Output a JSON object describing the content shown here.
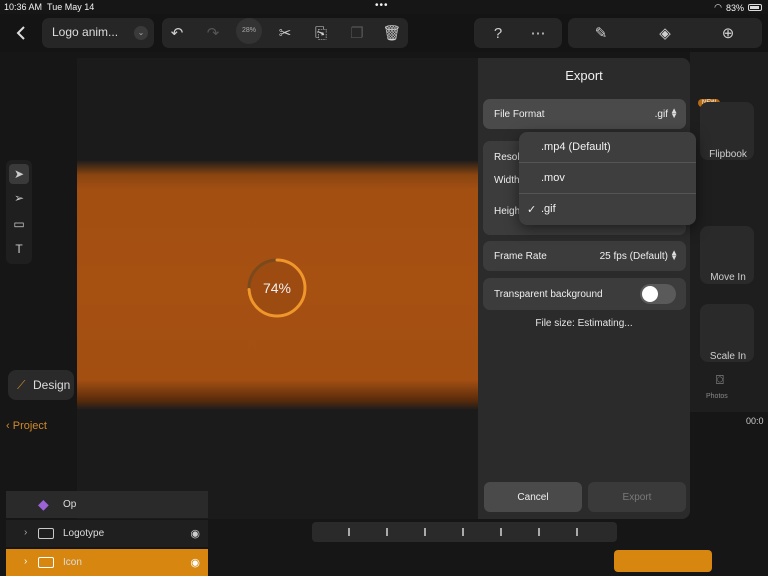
{
  "status": {
    "time": "10:36 AM",
    "date": "Tue May 14",
    "battery": "83%"
  },
  "toolbar": {
    "doc_title": "Logo anim...",
    "zoom_small": "28%"
  },
  "canvas": {
    "progress_label": "74%",
    "progress": 0.74
  },
  "right_panel": {
    "new_badge": "NEW",
    "items": [
      "Flipbook",
      "Move In",
      "Scale In"
    ],
    "photos_label": "Photos",
    "time": "00:0"
  },
  "export": {
    "title": "Export",
    "file_format_label": "File Format",
    "file_format_value": ".gif",
    "resolution_label": "Resol",
    "width_label": "Width",
    "height_label": "Heigh",
    "frame_rate_label": "Frame Rate",
    "frame_rate_value": "25 fps (Default)",
    "transparent_label": "Transparent background",
    "file_size": "File size:  Estimating...",
    "cancel": "Cancel",
    "export_btn": "Export",
    "options": [
      ".mp4 (Default)",
      ".mov",
      ".gif"
    ],
    "selected_option": ".gif"
  },
  "left": {
    "design_tab": "Design",
    "project_link": "Project",
    "layers": [
      "Op",
      "Logotype",
      "Icon"
    ]
  },
  "colors": {
    "accent": "#f0962a",
    "clip": "#d7860f"
  }
}
